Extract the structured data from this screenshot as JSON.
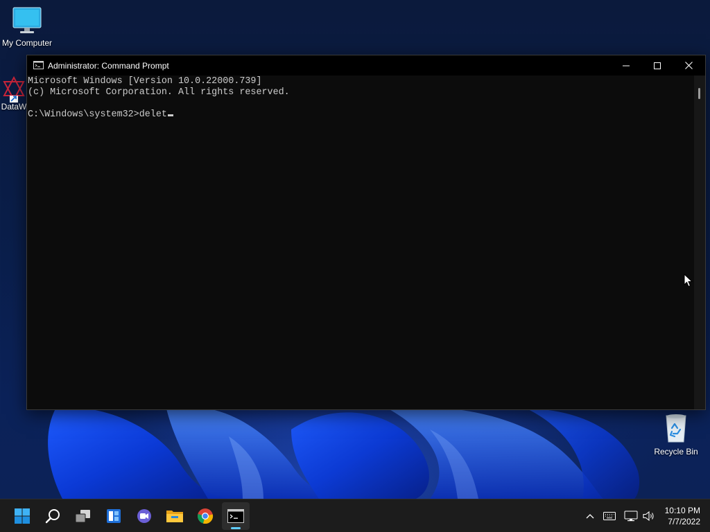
{
  "desktop": {
    "icons": [
      {
        "label": "My Computer"
      },
      {
        "label": "DataW"
      },
      {
        "label": "Recycle Bin"
      }
    ]
  },
  "window": {
    "title": "Administrator: Command Prompt",
    "console_lines": [
      "Microsoft Windows [Version 10.0.22000.739]",
      "(c) Microsoft Corporation. All rights reserved.",
      "",
      "C:\\Windows\\system32>delet"
    ]
  },
  "taskbar": {
    "apps": [
      "start-icon",
      "search-icon",
      "task-view-icon",
      "widgets-icon",
      "chat-icon",
      "file-explorer-icon",
      "chrome-icon",
      "terminal-icon"
    ],
    "active_app": "terminal-icon",
    "tray_icons": [
      "chevron-up-icon",
      "keyboard-icon",
      "network-icon",
      "volume-icon"
    ],
    "time": "10:10 PM",
    "date": "7/7/2022"
  },
  "colors": {
    "console_bg": "#0c0c0c",
    "console_text": "#cccccc",
    "taskbar_bg": "#1c1c1c",
    "accent": "#60cdff"
  }
}
